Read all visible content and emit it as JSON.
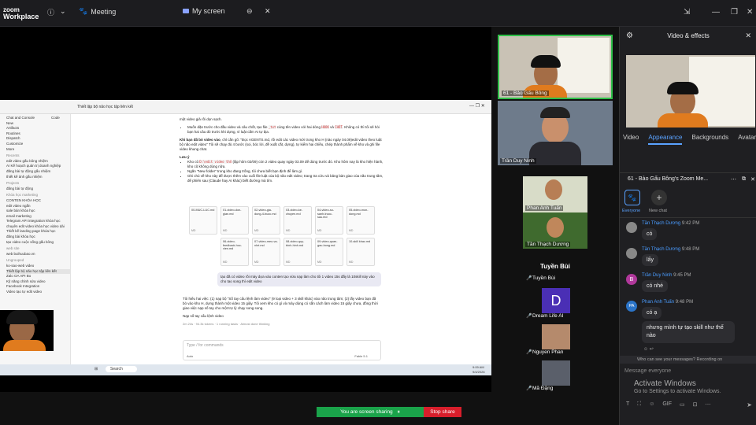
{
  "titlebar": {
    "brand_line1": "zoom",
    "brand_line2": "Workplace",
    "meeting_label": "Meeting",
    "myscreen_label": "My screen",
    "info_icon": "info-icon"
  },
  "shared_screen": {
    "tab_title": "Thiết lập bộ não học tập liên kết",
    "sidebar": {
      "top_items": [
        "Chat and Console",
        "Code",
        "New",
        "Artifacts",
        "Routines",
        "Dispatch",
        "Customize",
        "More"
      ],
      "recents_label": "Recents",
      "recents": [
        "edit video gấu bông nhiệm",
        "AI Kế hoạch quản trị doanh nghiệp",
        "đăng bài tự động gấu nhiệm",
        "thiết kế ảnh gấu nhiệm"
      ],
      "projects_label": "Projects",
      "projects": [
        "đăng bài tự động"
      ],
      "marketing_label": "Khóa học marketing",
      "marketing": [
        "CONTEN KHÓA HỌC",
        "edit video ngắn",
        "sale bán khóa học",
        "email marketing",
        "Telegram API integration khóa học",
        "chuyên edit video khóa học video dài",
        "Thiết kế landing page khóa học",
        "đăng bài khóa học",
        "tạo video cuộc sống gấu bông"
      ],
      "web_label": "web site",
      "web": [
        "web buihuubao.vn"
      ],
      "ung_label": "Ungrouped",
      "ung": [
        "ko-sao-web video",
        "Thiết lập bộ não học tập liên kết",
        "Zalo OA API Bo",
        "Kỹ năng chỉnh sửa video",
        "Facebook Integration",
        "Video tạo tự edit video"
      ]
    },
    "doc": {
      "line1": "một video giả rồi dọn sạch.",
      "bullet1": "Muốn dặn trước cho đầu video và câu chốt, tạo file",
      "bullet1_code": "_txt",
      "bullet1b": "cùng tên video với hai dòng",
      "hook": "HOOK",
      "and": "và",
      "cta": "CHỐT",
      "bullet1c": ". Không có thì tôi sẽ hỏi bạn hai câu đó trước khi dựng, vì luật cấm AI tự bịa.",
      "para2_bold": "Khi bạn đã bỏ video vào",
      "para2": ", chỉ cần gõ: \"Đọc AGENTS.md, rồi edit các video mới trong kho H (nào ngày 04.09)edit video theo luật bộ não edit video\" Tôi sẽ chạy đủ 4 bước (soi, bóc lời, đề xuất cắt, dựng), tự kiểm hai chiều, chép thành phẩm về kho và ghi file video khung chat.",
      "note_h": "Lưu ý",
      "note1": "Kho cũ",
      "note1_code": "D:\\edit video thô",
      "note1b": "(lập hôm 02/09) còn 2 video quay ngày 03.09 để dùng trước đó. Kho hôm nay là kho hiện hành, kho cũ không dùng nữa.",
      "note2": "Ngăn \"New folder\" trong kho đang trống, tôi chưa biết bạn định để làm gì.",
      "note3": "Ghi chú về kho này để được thêm vào cuối file luật của bộ não edit video; trang tra cứu và bảng bàn giao của não trung tâm, để phiên sau (Claude hay AI khác) biết đường mà tìm."
    },
    "folders": [
      [
        "00-MUC-LUC.md",
        "01-video-don-gian.md",
        "02-video-gia-dung-4-buoc.md",
        "03-video-ke-chuyen.md",
        "04-video-so-sanh-truoc-sau.md",
        "05-video-mon-dong.md"
      ],
      [
        "06-video-feedback-hoc-vien.md",
        "07-video-meo-va-nhé.md",
        "08-video-quy-trinh-hinh.md",
        "09-video-quan-gau-bong.md",
        "10-skill khac.md"
      ]
    ],
    "md_label": "MD",
    "bubble": "tạo đã có video rồi mày dựa vào conten tạo vừa nạp làm cho tôi 1 video 15s đấy là 10skill này vào cho tao song thì edit video",
    "reply": "Tôi hiểu hai việc: (1) nạp bộ \"Số tay cẩu lệnh làm video\" (9 loại video + 3 skill khác) vào não trung tâm; (2) lấy video bạn đã bỏ vào kho H, dựng thành một video 15 giây. Tôi xem kho có gì và máy dùng có sẵn cách làm video 15 giây chưa, đồng thời giao việc nạp số tay cho một trợ lý chạy song song.",
    "reply_link": "Nạp số tay cẩu lệnh video",
    "status_line": "2m 24s · 94.3k tokens · 1 running tasks · Almost done thinking",
    "input_placeholder": "Type / for commands",
    "input_label1": "Auto",
    "input_label2": "Fable 5.1",
    "taskbar_search": "Search",
    "taskbar_time": "9:09 AM",
    "taskbar_date": "9/4/2026"
  },
  "sharing_bar": {
    "status": "You are screen sharing",
    "stop": "Stop share"
  },
  "gallery": {
    "tile1_name": "61 - Bảo Gấu Bông",
    "tile2_name": "Trần Duy Ninh",
    "tile3_name": "Phan Anh Tuấn",
    "tile4_name": "Tần Thạch Dương",
    "big_name": "Tuyền Bùi",
    "list": [
      {
        "name": "Tuyền Bùi",
        "type": "none"
      },
      {
        "name": "Dream Life AI",
        "type": "letter",
        "letter": "D",
        "color": "#4a2fb5"
      },
      {
        "name": "Nguyen Phan",
        "type": "photo"
      },
      {
        "name": "Mã Đặng",
        "type": "photo"
      }
    ]
  },
  "side_panel": {
    "title": "Video & effects",
    "tabs": [
      "Video",
      "Appearance",
      "Backgrounds",
      "Avatars"
    ],
    "active_tab": "Appearance",
    "chat_title": "61 - Bảo Gấu Bông's Zoom Me...",
    "everyone_label": "Everyone",
    "newchat_label": "New chat",
    "messages": [
      {
        "name": "Tần Thạch Dương",
        "time": "9:42 PM",
        "text": "có",
        "avatar": "photo"
      },
      {
        "name": "Tần Thạch Dương",
        "time": "9:48 PM",
        "text": "lấy",
        "avatar": "photo"
      },
      {
        "name": "Trần Duy Ninh",
        "time": "9:45 PM",
        "text": "có nhé",
        "avatar": "B",
        "avcolor": "#b0389b"
      },
      {
        "name": "Phan Anh Tuấn",
        "time": "9:48 PM",
        "text": "có ạ",
        "avatar": "PA",
        "avcolor": "#2b74c8"
      },
      {
        "name": "",
        "time": "",
        "text": "nhưng mình tự tạo skill như thế nào",
        "avatar": "none"
      }
    ],
    "visibility_notice": "Who can see your messages? Recording on",
    "message_placeholder": "Message everyone",
    "activate_title": "Activate Windows",
    "activate_sub": "Go to Settings to activate Windows.",
    "gif_label": "GIF"
  },
  "colors": {
    "accent": "#5aa2ff",
    "share_green": "#1aa34a",
    "stop_red": "#d81e2b",
    "tile_border": "#2fbf48"
  }
}
